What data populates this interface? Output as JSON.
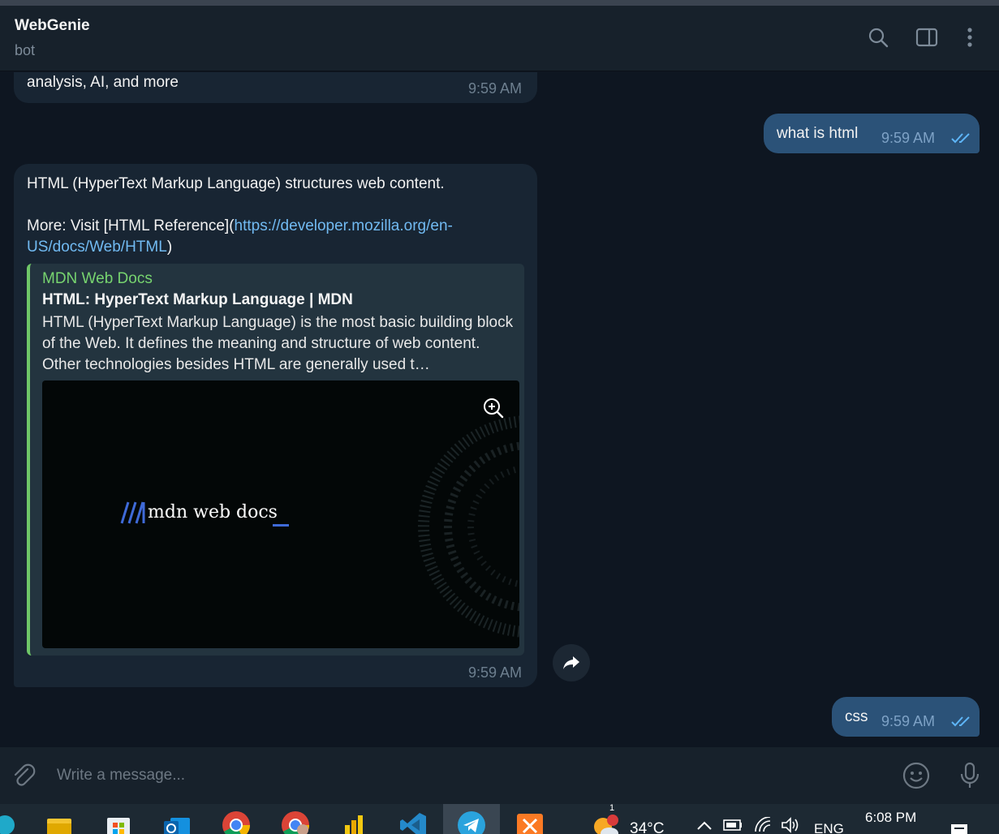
{
  "header": {
    "title": "WebGenie",
    "subtitle": "bot"
  },
  "messages": {
    "prev_partial_text": "analysis, AI, and more",
    "prev_time": "9:59 AM",
    "user1": {
      "text": "what is html",
      "time": "9:59 AM"
    },
    "bot_reply": {
      "line1": "HTML (HyperText Markup Language) structures web content.",
      "more_prefix": "More: Visit [HTML Reference](",
      "link_part1": "https://developer.mozilla.org/en-",
      "link_part2": "US/docs/Web/HTML",
      "more_suffix": ")",
      "time": "9:59 AM",
      "preview": {
        "site": "MDN Web Docs",
        "title": "HTML: HyperText Markup Language | MDN",
        "description": "HTML (HyperText Markup Language) is the most basic building block of the Web. It defines the meaning and structure of web content. Other technologies besides HTML are generally used t…",
        "image_logo_text": "mdn web docs"
      }
    },
    "user2": {
      "text": "css",
      "time": "9:59 AM"
    }
  },
  "composer": {
    "placeholder": "Write a message..."
  },
  "taskbar": {
    "weather_temp": "34°C",
    "weather_badge": "1",
    "language": "ENG",
    "clock": "6:08 PM"
  },
  "colors": {
    "accent_green": "#77d46f",
    "link_blue": "#71baf2",
    "outgoing_bubble": "#2b5278",
    "incoming_bubble": "#182533"
  }
}
